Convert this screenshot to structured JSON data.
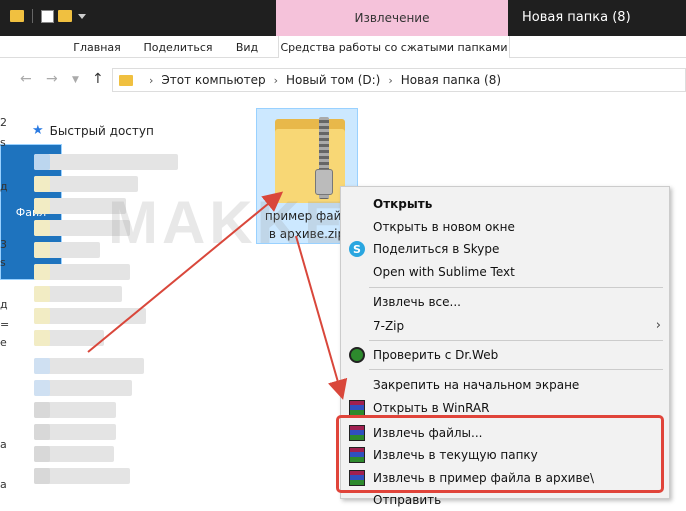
{
  "titlebar": {
    "context_tab_header": "Извлечение",
    "window_title": "Новая папка (8)"
  },
  "ribbon": {
    "tabs": [
      "Файл",
      "Главная",
      "Поделиться",
      "Вид"
    ],
    "context_tab": "Средства работы со сжатыми папками"
  },
  "address": {
    "crumbs": [
      "Этот компьютер",
      "Новый том (D:)",
      "Новая папка (8)"
    ]
  },
  "sidebar": {
    "quick_access": "Быстрый доступ"
  },
  "left_edge_glyphs": [
    "2",
    "s",
    "д",
    "3",
    "s",
    "д",
    "=",
    "e",
    "a",
    "a"
  ],
  "file": {
    "name_line1": "пример файл",
    "name_line2": "в архиве.zip"
  },
  "watermark": "MAKKEX.RU",
  "context_menu": {
    "items": [
      {
        "label": "Открыть",
        "icon": ""
      },
      {
        "label": "Открыть в новом окне",
        "icon": ""
      },
      {
        "label": "Поделиться в Skype",
        "icon": "skype-icon"
      },
      {
        "label": "Open with Sublime Text",
        "icon": ""
      },
      {
        "label": "Извлечь все...",
        "icon": ""
      },
      {
        "label": "7-Zip",
        "icon": "",
        "submenu": true
      },
      {
        "label": "Проверить с Dr.Web",
        "icon": "drweb-icon"
      },
      {
        "label": "Закрепить на начальном экране",
        "icon": ""
      },
      {
        "label": "Открыть в WinRAR",
        "icon": "winrar-icon"
      },
      {
        "label": "Извлечь файлы...",
        "icon": "winrar-icon"
      },
      {
        "label": "Извлечь в текущую папку",
        "icon": "winrar-icon"
      },
      {
        "label": "Извлечь в пример файла в архиве\\",
        "icon": "winrar-icon"
      },
      {
        "label": "Отправить",
        "icon": ""
      }
    ]
  },
  "colors": {
    "highlight": "#e0443a",
    "arrow": "#d9473b",
    "file_tab": "#1e73be",
    "context_header": "#f5c2da"
  }
}
